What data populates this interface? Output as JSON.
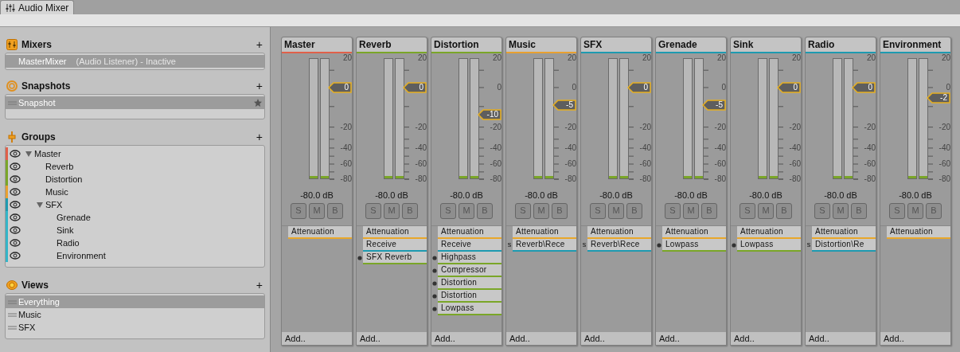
{
  "tab": {
    "label": "Audio Mixer"
  },
  "sidebar": {
    "mixers": {
      "title": "Mixers",
      "add": "+",
      "items": [
        {
          "name": "MasterMixer",
          "detail": "(Audio Listener) - Inactive",
          "selected": true
        }
      ]
    },
    "snapshots": {
      "title": "Snapshots",
      "add": "+",
      "items": [
        {
          "name": "Snapshot",
          "selected": true,
          "start": true
        }
      ]
    },
    "groups": {
      "title": "Groups",
      "add": "+",
      "tree": [
        {
          "name": "Master",
          "color": "#e0604a",
          "expanded": true,
          "children": [
            {
              "name": "Reverb",
              "color": "#7aa628"
            },
            {
              "name": "Distortion",
              "color": "#7aa628"
            },
            {
              "name": "Music",
              "color": "#e8a030"
            },
            {
              "name": "SFX",
              "color": "#1e9ab0",
              "expanded": true,
              "children": [
                {
                  "name": "Grenade",
                  "color": "#33b5c8"
                },
                {
                  "name": "Sink",
                  "color": "#33b5c8"
                },
                {
                  "name": "Radio",
                  "color": "#33b5c8"
                },
                {
                  "name": "Environment",
                  "color": "#33b5c8"
                }
              ]
            }
          ]
        }
      ]
    },
    "views": {
      "title": "Views",
      "add": "+",
      "items": [
        {
          "name": "Everything",
          "selected": true
        },
        {
          "name": "Music",
          "selected": false
        },
        {
          "name": "SFX",
          "selected": false
        }
      ]
    }
  },
  "strips": [
    {
      "name": "Master",
      "color": "#e0604a",
      "fader": {
        "value": "0",
        "level": 0.757
      },
      "meters": [
        {
          "level": 0.02
        },
        {
          "level": 0.02
        }
      ],
      "scale": {
        "plus20": "20",
        "minus20": "-20",
        "minus40": "-40",
        "minus60": "-60",
        "minus80": "-80"
      },
      "reading": "-80.0 dB",
      "buttons": [
        "S",
        "M",
        "B"
      ],
      "effects": [
        {
          "name": "Attenuation",
          "kind": "attenuation",
          "color": "#e8a72a"
        }
      ],
      "add": "Add.."
    },
    {
      "name": "Reverb",
      "color": "#7aa628",
      "fader": {
        "value": "0",
        "level": 0.757
      },
      "meters": [
        {
          "level": 0.02
        },
        {
          "level": 0.02
        }
      ],
      "scale": {
        "plus20": "20",
        "minus20": "-20",
        "minus40": "-40",
        "minus60": "-60",
        "minus80": "-80"
      },
      "reading": "-80.0 dB",
      "buttons": [
        "S",
        "M",
        "B"
      ],
      "effects": [
        {
          "name": "Attenuation",
          "kind": "attenuation",
          "color": "#e8a72a"
        },
        {
          "name": "Receive",
          "kind": "receive",
          "color": "#1e9ab0"
        },
        {
          "name": "SFX Reverb",
          "kind": "effect",
          "color": "#7aa628"
        }
      ],
      "add": "Add.."
    },
    {
      "name": "Distortion",
      "color": "#7aa628",
      "fader": {
        "value": "-10",
        "level": 0.53
      },
      "meters": [
        {
          "level": 0.02
        },
        {
          "level": 0.02
        }
      ],
      "scale": {
        "plus20": "20",
        "zero": "0",
        "minus20": "-20",
        "minus40": "-40",
        "minus60": "-60",
        "minus80": "-80"
      },
      "reading": "-80.0 dB",
      "buttons": [
        "S",
        "M",
        "B"
      ],
      "effects": [
        {
          "name": "Attenuation",
          "kind": "attenuation",
          "color": "#e8a72a"
        },
        {
          "name": "Receive",
          "kind": "receive",
          "color": "#1e9ab0"
        },
        {
          "name": "Highpass",
          "kind": "effect",
          "color": "#7aa628"
        },
        {
          "name": "Compressor",
          "kind": "effect",
          "color": "#7aa628"
        },
        {
          "name": "Distortion",
          "kind": "effect",
          "color": "#7aa628"
        },
        {
          "name": "Distortion",
          "kind": "effect",
          "color": "#7aa628"
        },
        {
          "name": "Lowpass",
          "kind": "effect",
          "color": "#7aa628"
        }
      ],
      "add": "Add.."
    },
    {
      "name": "Music",
      "color": "#e8a030",
      "fader": {
        "value": "-5",
        "level": 0.61
      },
      "meters": [
        {
          "level": 0.02
        },
        {
          "level": 0.02
        }
      ],
      "scale": {
        "plus20": "20",
        "zero": "0",
        "minus20": "-20",
        "minus40": "-40",
        "minus60": "-60",
        "minus80": "-80"
      },
      "reading": "-80.0 dB",
      "buttons": [
        "S",
        "M",
        "B"
      ],
      "effects": [
        {
          "name": "Attenuation",
          "kind": "attenuation",
          "color": "#e8a72a"
        },
        {
          "name": "Reverb\\Rece",
          "kind": "send",
          "marker": "s",
          "color": "#1e9ab0"
        }
      ],
      "add": "Add.."
    },
    {
      "name": "SFX",
      "color": "#1e9ab0",
      "fader": {
        "value": "0",
        "level": 0.757
      },
      "meters": [
        {
          "level": 0.02
        },
        {
          "level": 0.02
        }
      ],
      "scale": {
        "plus20": "20",
        "minus20": "-20",
        "minus40": "-40",
        "minus60": "-60",
        "minus80": "-80"
      },
      "reading": "-80.0 dB",
      "buttons": [
        "S",
        "M",
        "B"
      ],
      "effects": [
        {
          "name": "Attenuation",
          "kind": "attenuation",
          "color": "#e8a72a"
        },
        {
          "name": "Reverb\\Rece",
          "kind": "send",
          "marker": "s",
          "color": "#1e9ab0"
        }
      ],
      "add": "Add.."
    },
    {
      "name": "Grenade",
      "color": "#1e9ab0",
      "fader": {
        "value": "-5",
        "level": 0.61
      },
      "meters": [
        {
          "level": 0.02
        },
        {
          "level": 0.02
        }
      ],
      "scale": {
        "plus20": "20",
        "zero": "0",
        "minus20": "-20",
        "minus40": "-40",
        "minus60": "-60",
        "minus80": "-80"
      },
      "reading": "-80.0 dB",
      "buttons": [
        "S",
        "M",
        "B"
      ],
      "effects": [
        {
          "name": "Attenuation",
          "kind": "attenuation",
          "color": "#e8a72a"
        },
        {
          "name": "Lowpass",
          "kind": "effect",
          "color": "#7aa628"
        }
      ],
      "add": "Add.."
    },
    {
      "name": "Sink",
      "color": "#1e9ab0",
      "fader": {
        "value": "0",
        "level": 0.757
      },
      "meters": [
        {
          "level": 0.02
        },
        {
          "level": 0.02
        }
      ],
      "scale": {
        "plus20": "20",
        "minus20": "-20",
        "minus40": "-40",
        "minus60": "-60",
        "minus80": "-80"
      },
      "reading": "-80.0 dB",
      "buttons": [
        "S",
        "M",
        "B"
      ],
      "effects": [
        {
          "name": "Attenuation",
          "kind": "attenuation",
          "color": "#e8a72a"
        },
        {
          "name": "Lowpass",
          "kind": "effect",
          "color": "#7aa628"
        }
      ],
      "add": "Add.."
    },
    {
      "name": "Radio",
      "color": "#1e9ab0",
      "fader": {
        "value": "0",
        "level": 0.757
      },
      "meters": [
        {
          "level": 0.02
        },
        {
          "level": 0.02
        }
      ],
      "scale": {
        "plus20": "20",
        "minus20": "-20",
        "minus40": "-40",
        "minus60": "-60",
        "minus80": "-80"
      },
      "reading": "-80.0 dB",
      "buttons": [
        "S",
        "M",
        "B"
      ],
      "effects": [
        {
          "name": "Attenuation",
          "kind": "attenuation",
          "color": "#e8a72a"
        },
        {
          "name": "Distortion\\Re",
          "kind": "send",
          "marker": "s",
          "color": "#1e9ab0"
        }
      ],
      "add": "Add.."
    },
    {
      "name": "Environment",
      "color": "#1e9ab0",
      "fader": {
        "value": "-2",
        "level": 0.67
      },
      "meters": [
        {
          "level": 0.02
        },
        {
          "level": 0.02
        }
      ],
      "scale": {
        "plus20": "20",
        "zero": "0",
        "minus20": "-20",
        "minus40": "-40",
        "minus60": "-60",
        "minus80": "-80"
      },
      "reading": "-80.0 dB",
      "buttons": [
        "S",
        "M",
        "B"
      ],
      "effects": [
        {
          "name": "Attenuation",
          "kind": "attenuation",
          "color": "#e8a72a"
        }
      ],
      "add": "Add.."
    }
  ]
}
